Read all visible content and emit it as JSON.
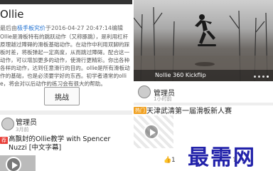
{
  "left_post": {
    "title": "Ollie",
    "meta_prefix": "最后由",
    "meta_link": "极手板究价",
    "meta_suffix": "于2016-04-27 20:47:14编辑",
    "body": "Ollie是滑板特有的跳跃动作（又称豚跳），是利用杠杆原理越过障碍的滑板基础动作。在动作中利用双脚的踩板时差，将板弹起一定高度，从而跳过障碍。配合这一动作，可以增加更多的动作，使滑行更精彩。你出各种各样的动作，达到任意滑行的目的。ollie是所有滑板动作的基础，也是必须要学好的东西。初学者通常的ollie，将会对以后动作的练习会有很大的帮助。",
    "challenge_button": "挑战"
  },
  "left_card": {
    "author": "管理员",
    "time": "3月前",
    "tag": "荐",
    "title": "高飘封的Ollie教学 with Spencer Nuzzi [中文字幕]"
  },
  "right_video": {
    "caption": "Nollie 360 Kickflip",
    "dots_total": 4,
    "active_dot": 4
  },
  "right_card": {
    "author": "管理员",
    "time": "1小时前",
    "tag": "热门",
    "title": "天津武清第一届滑板新人赛",
    "like_count": "1"
  },
  "watermark": "最需网",
  "colors": {
    "link": "#1e6fd0",
    "tag_red": "#e8403a",
    "tag_orange": "#f0a020",
    "watermark": "#2222aa"
  }
}
